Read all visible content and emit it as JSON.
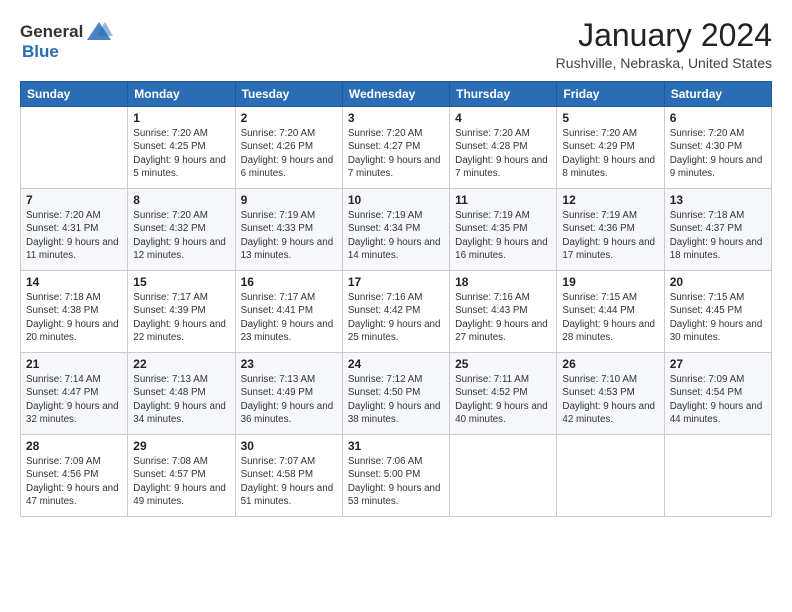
{
  "header": {
    "logo_general": "General",
    "logo_blue": "Blue",
    "month_title": "January 2024",
    "location": "Rushville, Nebraska, United States"
  },
  "weekdays": [
    "Sunday",
    "Monday",
    "Tuesday",
    "Wednesday",
    "Thursday",
    "Friday",
    "Saturday"
  ],
  "weeks": [
    [
      {
        "day": "",
        "sunrise": "",
        "sunset": "",
        "daylight": ""
      },
      {
        "day": "1",
        "sunrise": "Sunrise: 7:20 AM",
        "sunset": "Sunset: 4:25 PM",
        "daylight": "Daylight: 9 hours and 5 minutes."
      },
      {
        "day": "2",
        "sunrise": "Sunrise: 7:20 AM",
        "sunset": "Sunset: 4:26 PM",
        "daylight": "Daylight: 9 hours and 6 minutes."
      },
      {
        "day": "3",
        "sunrise": "Sunrise: 7:20 AM",
        "sunset": "Sunset: 4:27 PM",
        "daylight": "Daylight: 9 hours and 7 minutes."
      },
      {
        "day": "4",
        "sunrise": "Sunrise: 7:20 AM",
        "sunset": "Sunset: 4:28 PM",
        "daylight": "Daylight: 9 hours and 7 minutes."
      },
      {
        "day": "5",
        "sunrise": "Sunrise: 7:20 AM",
        "sunset": "Sunset: 4:29 PM",
        "daylight": "Daylight: 9 hours and 8 minutes."
      },
      {
        "day": "6",
        "sunrise": "Sunrise: 7:20 AM",
        "sunset": "Sunset: 4:30 PM",
        "daylight": "Daylight: 9 hours and 9 minutes."
      }
    ],
    [
      {
        "day": "7",
        "sunrise": "",
        "sunset": "",
        "daylight": ""
      },
      {
        "day": "8",
        "sunrise": "Sunrise: 7:20 AM",
        "sunset": "Sunset: 4:32 PM",
        "daylight": "Daylight: 9 hours and 12 minutes."
      },
      {
        "day": "9",
        "sunrise": "Sunrise: 7:19 AM",
        "sunset": "Sunset: 4:33 PM",
        "daylight": "Daylight: 9 hours and 13 minutes."
      },
      {
        "day": "10",
        "sunrise": "Sunrise: 7:19 AM",
        "sunset": "Sunset: 4:34 PM",
        "daylight": "Daylight: 9 hours and 14 minutes."
      },
      {
        "day": "11",
        "sunrise": "Sunrise: 7:19 AM",
        "sunset": "Sunset: 4:35 PM",
        "daylight": "Daylight: 9 hours and 16 minutes."
      },
      {
        "day": "12",
        "sunrise": "Sunrise: 7:19 AM",
        "sunset": "Sunset: 4:36 PM",
        "daylight": "Daylight: 9 hours and 17 minutes."
      },
      {
        "day": "13",
        "sunrise": "Sunrise: 7:18 AM",
        "sunset": "Sunset: 4:37 PM",
        "daylight": "Daylight: 9 hours and 18 minutes."
      }
    ],
    [
      {
        "day": "14",
        "sunrise": "",
        "sunset": "",
        "daylight": ""
      },
      {
        "day": "15",
        "sunrise": "Sunrise: 7:17 AM",
        "sunset": "Sunset: 4:39 PM",
        "daylight": "Daylight: 9 hours and 22 minutes."
      },
      {
        "day": "16",
        "sunrise": "Sunrise: 7:17 AM",
        "sunset": "Sunset: 4:41 PM",
        "daylight": "Daylight: 9 hours and 23 minutes."
      },
      {
        "day": "17",
        "sunrise": "Sunrise: 7:16 AM",
        "sunset": "Sunset: 4:42 PM",
        "daylight": "Daylight: 9 hours and 25 minutes."
      },
      {
        "day": "18",
        "sunrise": "Sunrise: 7:16 AM",
        "sunset": "Sunset: 4:43 PM",
        "daylight": "Daylight: 9 hours and 27 minutes."
      },
      {
        "day": "19",
        "sunrise": "Sunrise: 7:15 AM",
        "sunset": "Sunset: 4:44 PM",
        "daylight": "Daylight: 9 hours and 28 minutes."
      },
      {
        "day": "20",
        "sunrise": "Sunrise: 7:15 AM",
        "sunset": "Sunset: 4:45 PM",
        "daylight": "Daylight: 9 hours and 30 minutes."
      }
    ],
    [
      {
        "day": "21",
        "sunrise": "",
        "sunset": "",
        "daylight": ""
      },
      {
        "day": "22",
        "sunrise": "Sunrise: 7:13 AM",
        "sunset": "Sunset: 4:48 PM",
        "daylight": "Daylight: 9 hours and 34 minutes."
      },
      {
        "day": "23",
        "sunrise": "Sunrise: 7:13 AM",
        "sunset": "Sunset: 4:49 PM",
        "daylight": "Daylight: 9 hours and 36 minutes."
      },
      {
        "day": "24",
        "sunrise": "Sunrise: 7:12 AM",
        "sunset": "Sunset: 4:50 PM",
        "daylight": "Daylight: 9 hours and 38 minutes."
      },
      {
        "day": "25",
        "sunrise": "Sunrise: 7:11 AM",
        "sunset": "Sunset: 4:52 PM",
        "daylight": "Daylight: 9 hours and 40 minutes."
      },
      {
        "day": "26",
        "sunrise": "Sunrise: 7:10 AM",
        "sunset": "Sunset: 4:53 PM",
        "daylight": "Daylight: 9 hours and 42 minutes."
      },
      {
        "day": "27",
        "sunrise": "Sunrise: 7:09 AM",
        "sunset": "Sunset: 4:54 PM",
        "daylight": "Daylight: 9 hours and 44 minutes."
      }
    ],
    [
      {
        "day": "28",
        "sunrise": "Sunrise: 7:09 AM",
        "sunset": "Sunset: 4:56 PM",
        "daylight": "Daylight: 9 hours and 47 minutes."
      },
      {
        "day": "29",
        "sunrise": "Sunrise: 7:08 AM",
        "sunset": "Sunset: 4:57 PM",
        "daylight": "Daylight: 9 hours and 49 minutes."
      },
      {
        "day": "30",
        "sunrise": "Sunrise: 7:07 AM",
        "sunset": "Sunset: 4:58 PM",
        "daylight": "Daylight: 9 hours and 51 minutes."
      },
      {
        "day": "31",
        "sunrise": "Sunrise: 7:06 AM",
        "sunset": "Sunset: 5:00 PM",
        "daylight": "Daylight: 9 hours and 53 minutes."
      },
      {
        "day": "",
        "sunrise": "",
        "sunset": "",
        "daylight": ""
      },
      {
        "day": "",
        "sunrise": "",
        "sunset": "",
        "daylight": ""
      },
      {
        "day": "",
        "sunrise": "",
        "sunset": "",
        "daylight": ""
      }
    ]
  ],
  "week1_sunday": {
    "sunrise": "Sunrise: 7:20 AM",
    "sunset": "Sunset: 4:31 PM",
    "daylight": "Daylight: 9 hours and 11 minutes."
  },
  "week3_sunday": {
    "sunrise": "Sunrise: 7:18 AM",
    "sunset": "Sunset: 4:38 PM",
    "daylight": "Daylight: 9 hours and 20 minutes."
  },
  "week4_sunday": {
    "sunrise": "Sunrise: 7:14 AM",
    "sunset": "Sunset: 4:47 PM",
    "daylight": "Daylight: 9 hours and 32 minutes."
  }
}
